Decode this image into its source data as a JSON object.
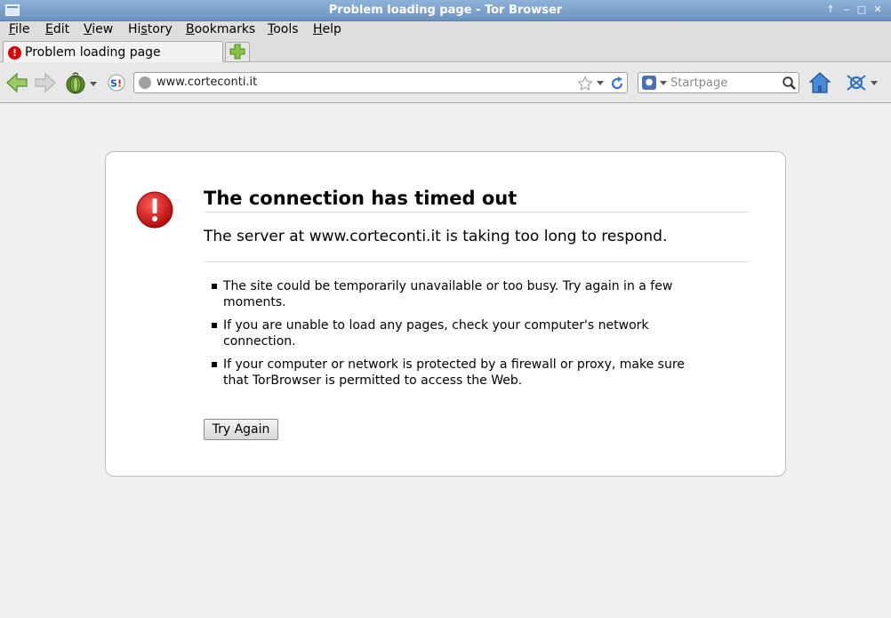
{
  "window": {
    "title": "Problem loading page - Tor Browser"
  },
  "menubar": {
    "items": [
      {
        "label": "File",
        "underline": "F",
        "rest": "ile"
      },
      {
        "label": "Edit",
        "underline": "E",
        "rest": "dit"
      },
      {
        "label": "View",
        "underline": "V",
        "rest": "iew"
      },
      {
        "label": "History",
        "pre": "Hi",
        "underline": "s",
        "rest": "tory"
      },
      {
        "label": "Bookmarks",
        "underline": "B",
        "rest": "ookmarks"
      },
      {
        "label": "Tools",
        "underline": "T",
        "rest": "ools"
      },
      {
        "label": "Help",
        "underline": "H",
        "rest": "elp"
      }
    ]
  },
  "tabs": {
    "active_label": "Problem loading page",
    "active_icon": "error-icon"
  },
  "navbar": {
    "url": "www.corteconti.it",
    "search_placeholder": "Startpage"
  },
  "error": {
    "title": "The connection has timed out",
    "short_desc": "The server at www.corteconti.it is taking too long to respond.",
    "bullets": [
      "The site could be temporarily unavailable or too busy. Try again in a few moments.",
      "If you are unable to load any pages, check your computer's network connection.",
      "If your computer or network is protected by a firewall or proxy, make sure that TorBrowser is permitted to access the Web."
    ],
    "try_again_label": "Try Again"
  },
  "colors": {
    "titlebar": "#6c93c1",
    "error_red": "#cc1111",
    "back_arrow": "#7cb342",
    "home_icon": "#3a78c9"
  }
}
